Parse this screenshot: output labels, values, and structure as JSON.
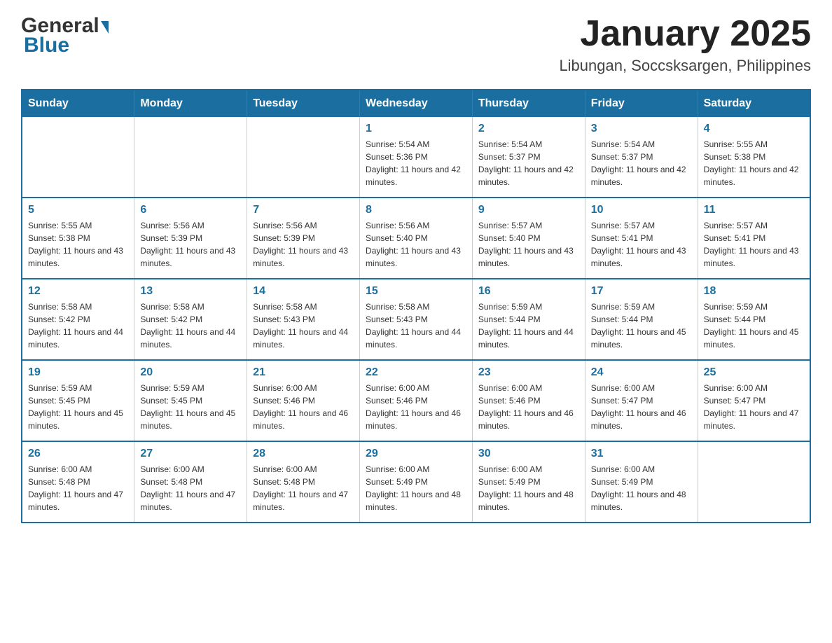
{
  "logo": {
    "general": "General",
    "blue": "Blue"
  },
  "header": {
    "month_year": "January 2025",
    "location": "Libungan, Soccsksargen, Philippines"
  },
  "weekdays": [
    "Sunday",
    "Monday",
    "Tuesday",
    "Wednesday",
    "Thursday",
    "Friday",
    "Saturday"
  ],
  "weeks": [
    [
      {
        "day": "",
        "info": ""
      },
      {
        "day": "",
        "info": ""
      },
      {
        "day": "",
        "info": ""
      },
      {
        "day": "1",
        "info": "Sunrise: 5:54 AM\nSunset: 5:36 PM\nDaylight: 11 hours and 42 minutes."
      },
      {
        "day": "2",
        "info": "Sunrise: 5:54 AM\nSunset: 5:37 PM\nDaylight: 11 hours and 42 minutes."
      },
      {
        "day": "3",
        "info": "Sunrise: 5:54 AM\nSunset: 5:37 PM\nDaylight: 11 hours and 42 minutes."
      },
      {
        "day": "4",
        "info": "Sunrise: 5:55 AM\nSunset: 5:38 PM\nDaylight: 11 hours and 42 minutes."
      }
    ],
    [
      {
        "day": "5",
        "info": "Sunrise: 5:55 AM\nSunset: 5:38 PM\nDaylight: 11 hours and 43 minutes."
      },
      {
        "day": "6",
        "info": "Sunrise: 5:56 AM\nSunset: 5:39 PM\nDaylight: 11 hours and 43 minutes."
      },
      {
        "day": "7",
        "info": "Sunrise: 5:56 AM\nSunset: 5:39 PM\nDaylight: 11 hours and 43 minutes."
      },
      {
        "day": "8",
        "info": "Sunrise: 5:56 AM\nSunset: 5:40 PM\nDaylight: 11 hours and 43 minutes."
      },
      {
        "day": "9",
        "info": "Sunrise: 5:57 AM\nSunset: 5:40 PM\nDaylight: 11 hours and 43 minutes."
      },
      {
        "day": "10",
        "info": "Sunrise: 5:57 AM\nSunset: 5:41 PM\nDaylight: 11 hours and 43 minutes."
      },
      {
        "day": "11",
        "info": "Sunrise: 5:57 AM\nSunset: 5:41 PM\nDaylight: 11 hours and 43 minutes."
      }
    ],
    [
      {
        "day": "12",
        "info": "Sunrise: 5:58 AM\nSunset: 5:42 PM\nDaylight: 11 hours and 44 minutes."
      },
      {
        "day": "13",
        "info": "Sunrise: 5:58 AM\nSunset: 5:42 PM\nDaylight: 11 hours and 44 minutes."
      },
      {
        "day": "14",
        "info": "Sunrise: 5:58 AM\nSunset: 5:43 PM\nDaylight: 11 hours and 44 minutes."
      },
      {
        "day": "15",
        "info": "Sunrise: 5:58 AM\nSunset: 5:43 PM\nDaylight: 11 hours and 44 minutes."
      },
      {
        "day": "16",
        "info": "Sunrise: 5:59 AM\nSunset: 5:44 PM\nDaylight: 11 hours and 44 minutes."
      },
      {
        "day": "17",
        "info": "Sunrise: 5:59 AM\nSunset: 5:44 PM\nDaylight: 11 hours and 45 minutes."
      },
      {
        "day": "18",
        "info": "Sunrise: 5:59 AM\nSunset: 5:44 PM\nDaylight: 11 hours and 45 minutes."
      }
    ],
    [
      {
        "day": "19",
        "info": "Sunrise: 5:59 AM\nSunset: 5:45 PM\nDaylight: 11 hours and 45 minutes."
      },
      {
        "day": "20",
        "info": "Sunrise: 5:59 AM\nSunset: 5:45 PM\nDaylight: 11 hours and 45 minutes."
      },
      {
        "day": "21",
        "info": "Sunrise: 6:00 AM\nSunset: 5:46 PM\nDaylight: 11 hours and 46 minutes."
      },
      {
        "day": "22",
        "info": "Sunrise: 6:00 AM\nSunset: 5:46 PM\nDaylight: 11 hours and 46 minutes."
      },
      {
        "day": "23",
        "info": "Sunrise: 6:00 AM\nSunset: 5:46 PM\nDaylight: 11 hours and 46 minutes."
      },
      {
        "day": "24",
        "info": "Sunrise: 6:00 AM\nSunset: 5:47 PM\nDaylight: 11 hours and 46 minutes."
      },
      {
        "day": "25",
        "info": "Sunrise: 6:00 AM\nSunset: 5:47 PM\nDaylight: 11 hours and 47 minutes."
      }
    ],
    [
      {
        "day": "26",
        "info": "Sunrise: 6:00 AM\nSunset: 5:48 PM\nDaylight: 11 hours and 47 minutes."
      },
      {
        "day": "27",
        "info": "Sunrise: 6:00 AM\nSunset: 5:48 PM\nDaylight: 11 hours and 47 minutes."
      },
      {
        "day": "28",
        "info": "Sunrise: 6:00 AM\nSunset: 5:48 PM\nDaylight: 11 hours and 47 minutes."
      },
      {
        "day": "29",
        "info": "Sunrise: 6:00 AM\nSunset: 5:49 PM\nDaylight: 11 hours and 48 minutes."
      },
      {
        "day": "30",
        "info": "Sunrise: 6:00 AM\nSunset: 5:49 PM\nDaylight: 11 hours and 48 minutes."
      },
      {
        "day": "31",
        "info": "Sunrise: 6:00 AM\nSunset: 5:49 PM\nDaylight: 11 hours and 48 minutes."
      },
      {
        "day": "",
        "info": ""
      }
    ]
  ]
}
